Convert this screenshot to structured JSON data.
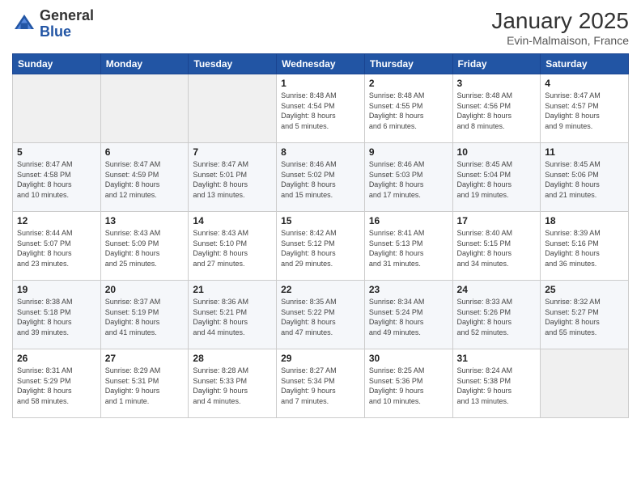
{
  "header": {
    "logo_general": "General",
    "logo_blue": "Blue",
    "month_title": "January 2025",
    "location": "Evin-Malmaison, France"
  },
  "days_of_week": [
    "Sunday",
    "Monday",
    "Tuesday",
    "Wednesday",
    "Thursday",
    "Friday",
    "Saturday"
  ],
  "weeks": [
    [
      {
        "day": "",
        "info": ""
      },
      {
        "day": "",
        "info": ""
      },
      {
        "day": "",
        "info": ""
      },
      {
        "day": "1",
        "info": "Sunrise: 8:48 AM\nSunset: 4:54 PM\nDaylight: 8 hours\nand 5 minutes."
      },
      {
        "day": "2",
        "info": "Sunrise: 8:48 AM\nSunset: 4:55 PM\nDaylight: 8 hours\nand 6 minutes."
      },
      {
        "day": "3",
        "info": "Sunrise: 8:48 AM\nSunset: 4:56 PM\nDaylight: 8 hours\nand 8 minutes."
      },
      {
        "day": "4",
        "info": "Sunrise: 8:47 AM\nSunset: 4:57 PM\nDaylight: 8 hours\nand 9 minutes."
      }
    ],
    [
      {
        "day": "5",
        "info": "Sunrise: 8:47 AM\nSunset: 4:58 PM\nDaylight: 8 hours\nand 10 minutes."
      },
      {
        "day": "6",
        "info": "Sunrise: 8:47 AM\nSunset: 4:59 PM\nDaylight: 8 hours\nand 12 minutes."
      },
      {
        "day": "7",
        "info": "Sunrise: 8:47 AM\nSunset: 5:01 PM\nDaylight: 8 hours\nand 13 minutes."
      },
      {
        "day": "8",
        "info": "Sunrise: 8:46 AM\nSunset: 5:02 PM\nDaylight: 8 hours\nand 15 minutes."
      },
      {
        "day": "9",
        "info": "Sunrise: 8:46 AM\nSunset: 5:03 PM\nDaylight: 8 hours\nand 17 minutes."
      },
      {
        "day": "10",
        "info": "Sunrise: 8:45 AM\nSunset: 5:04 PM\nDaylight: 8 hours\nand 19 minutes."
      },
      {
        "day": "11",
        "info": "Sunrise: 8:45 AM\nSunset: 5:06 PM\nDaylight: 8 hours\nand 21 minutes."
      }
    ],
    [
      {
        "day": "12",
        "info": "Sunrise: 8:44 AM\nSunset: 5:07 PM\nDaylight: 8 hours\nand 23 minutes."
      },
      {
        "day": "13",
        "info": "Sunrise: 8:43 AM\nSunset: 5:09 PM\nDaylight: 8 hours\nand 25 minutes."
      },
      {
        "day": "14",
        "info": "Sunrise: 8:43 AM\nSunset: 5:10 PM\nDaylight: 8 hours\nand 27 minutes."
      },
      {
        "day": "15",
        "info": "Sunrise: 8:42 AM\nSunset: 5:12 PM\nDaylight: 8 hours\nand 29 minutes."
      },
      {
        "day": "16",
        "info": "Sunrise: 8:41 AM\nSunset: 5:13 PM\nDaylight: 8 hours\nand 31 minutes."
      },
      {
        "day": "17",
        "info": "Sunrise: 8:40 AM\nSunset: 5:15 PM\nDaylight: 8 hours\nand 34 minutes."
      },
      {
        "day": "18",
        "info": "Sunrise: 8:39 AM\nSunset: 5:16 PM\nDaylight: 8 hours\nand 36 minutes."
      }
    ],
    [
      {
        "day": "19",
        "info": "Sunrise: 8:38 AM\nSunset: 5:18 PM\nDaylight: 8 hours\nand 39 minutes."
      },
      {
        "day": "20",
        "info": "Sunrise: 8:37 AM\nSunset: 5:19 PM\nDaylight: 8 hours\nand 41 minutes."
      },
      {
        "day": "21",
        "info": "Sunrise: 8:36 AM\nSunset: 5:21 PM\nDaylight: 8 hours\nand 44 minutes."
      },
      {
        "day": "22",
        "info": "Sunrise: 8:35 AM\nSunset: 5:22 PM\nDaylight: 8 hours\nand 47 minutes."
      },
      {
        "day": "23",
        "info": "Sunrise: 8:34 AM\nSunset: 5:24 PM\nDaylight: 8 hours\nand 49 minutes."
      },
      {
        "day": "24",
        "info": "Sunrise: 8:33 AM\nSunset: 5:26 PM\nDaylight: 8 hours\nand 52 minutes."
      },
      {
        "day": "25",
        "info": "Sunrise: 8:32 AM\nSunset: 5:27 PM\nDaylight: 8 hours\nand 55 minutes."
      }
    ],
    [
      {
        "day": "26",
        "info": "Sunrise: 8:31 AM\nSunset: 5:29 PM\nDaylight: 8 hours\nand 58 minutes."
      },
      {
        "day": "27",
        "info": "Sunrise: 8:29 AM\nSunset: 5:31 PM\nDaylight: 9 hours\nand 1 minute."
      },
      {
        "day": "28",
        "info": "Sunrise: 8:28 AM\nSunset: 5:33 PM\nDaylight: 9 hours\nand 4 minutes."
      },
      {
        "day": "29",
        "info": "Sunrise: 8:27 AM\nSunset: 5:34 PM\nDaylight: 9 hours\nand 7 minutes."
      },
      {
        "day": "30",
        "info": "Sunrise: 8:25 AM\nSunset: 5:36 PM\nDaylight: 9 hours\nand 10 minutes."
      },
      {
        "day": "31",
        "info": "Sunrise: 8:24 AM\nSunset: 5:38 PM\nDaylight: 9 hours\nand 13 minutes."
      },
      {
        "day": "",
        "info": ""
      }
    ]
  ]
}
